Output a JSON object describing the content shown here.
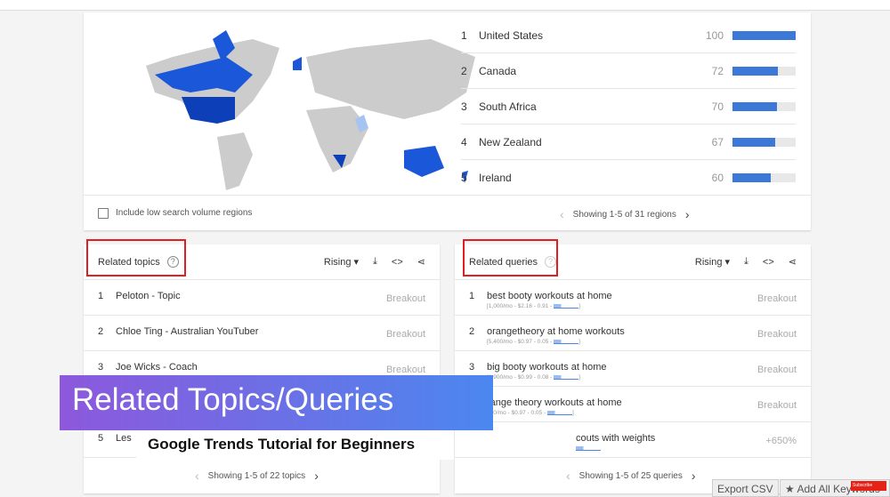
{
  "regions": {
    "items": [
      {
        "rank": "1",
        "name": "United States",
        "value": "100",
        "pct": 100
      },
      {
        "rank": "2",
        "name": "Canada",
        "value": "72",
        "pct": 72
      },
      {
        "rank": "3",
        "name": "South Africa",
        "value": "70",
        "pct": 70
      },
      {
        "rank": "4",
        "name": "New Zealand",
        "value": "67",
        "pct": 67
      },
      {
        "rank": "5",
        "name": "Ireland",
        "value": "60",
        "pct": 60
      }
    ],
    "low_volume_label": "Include low search volume regions",
    "pager": "Showing 1-5 of 31 regions"
  },
  "topics": {
    "title": "Related topics",
    "filter": "Rising",
    "items": [
      {
        "rank": "1",
        "text": "Peloton - Topic",
        "value": "Breakout"
      },
      {
        "rank": "2",
        "text": "Chloe Ting - Australian YouTuber",
        "value": "Breakout"
      },
      {
        "rank": "3",
        "text": "Joe Wicks - Coach",
        "value": "Breakout"
      },
      {
        "rank": "4",
        "text": "",
        "value": ""
      },
      {
        "rank": "5",
        "text": "Les",
        "value": ""
      }
    ],
    "pager": "Showing 1-5 of 22 topics"
  },
  "queries": {
    "title": "Related queries",
    "filter": "Rising",
    "items": [
      {
        "rank": "1",
        "text": "best booty workouts at home",
        "sub": "[1,000/mo - $2.16 - 0.91 -",
        "value": "Breakout"
      },
      {
        "rank": "2",
        "text": "orangetheory at home workouts",
        "sub": "[5,400/mo - $0.97 - 0.05 -",
        "value": "Breakout"
      },
      {
        "rank": "3",
        "text": "big booty workouts at home",
        "sub": "[1,900/mo - $0.99 - 0.08 -",
        "value": "Breakout"
      },
      {
        "rank": "",
        "text": "range theory workouts at home",
        "sub": "400/mo - $0.97 - 0.05 -",
        "value": "Breakout"
      },
      {
        "rank": "",
        "text": "couts with weights",
        "sub": "",
        "value": "+650%"
      }
    ],
    "pager": "Showing 1-5 of 25 queries"
  },
  "overlay": {
    "title": "Related Topics/Queries",
    "subtitle": "Google Trends Tutorial for Beginners"
  },
  "buttons": {
    "export": "Export CSV",
    "add_all": "Add All Keywords",
    "subscribe": "Subscribe"
  },
  "colors": {
    "bar": "#3c78d8",
    "highlight": "#e02020"
  }
}
